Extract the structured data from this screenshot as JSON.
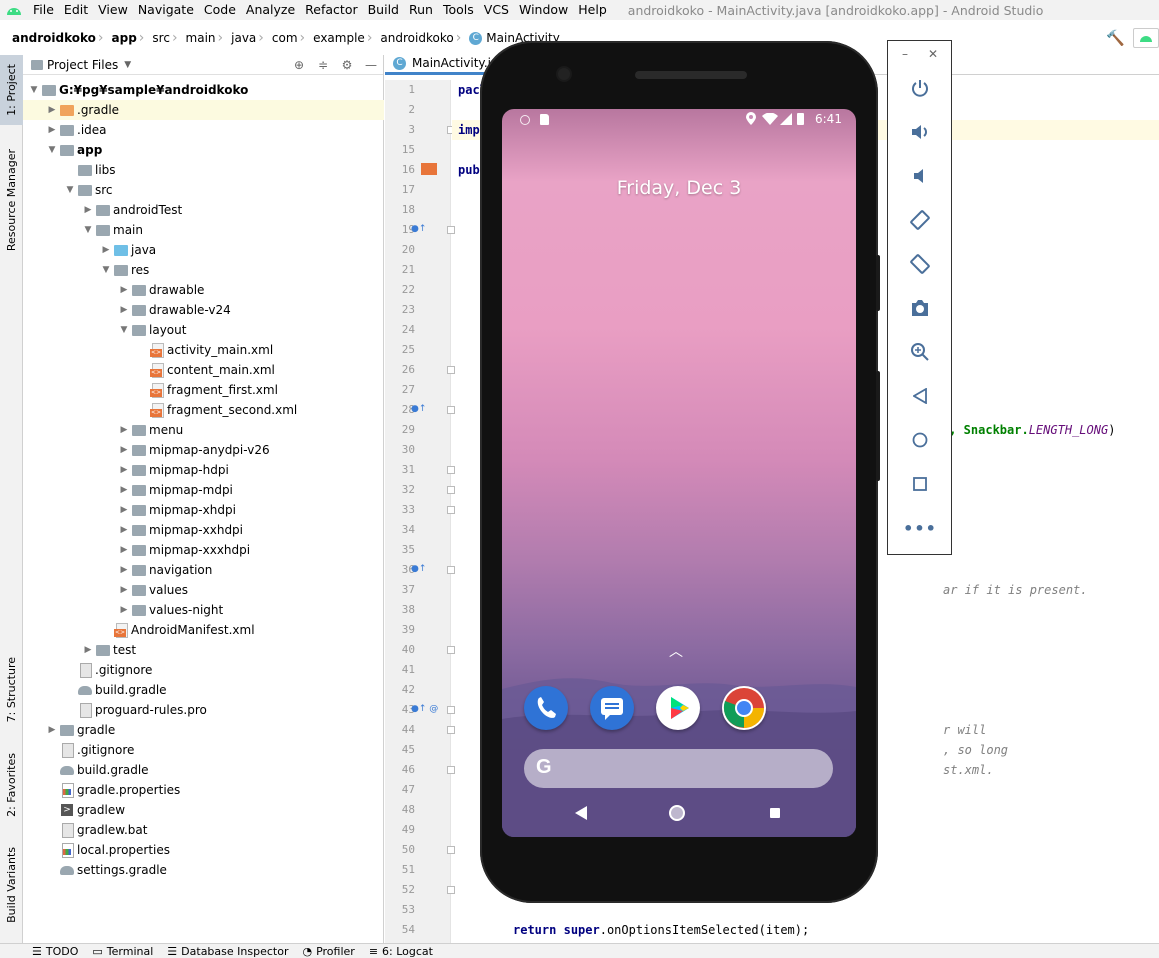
{
  "menubar": {
    "items": [
      "File",
      "Edit",
      "View",
      "Navigate",
      "Code",
      "Analyze",
      "Refactor",
      "Build",
      "Run",
      "Tools",
      "VCS",
      "Window",
      "Help"
    ],
    "window_title": "androidkoko - MainActivity.java [androidkoko.app] - Android Studio"
  },
  "breadcrumb": [
    "androidkoko",
    "app",
    "src",
    "main",
    "java",
    "com",
    "example",
    "androidkoko",
    "MainActivity"
  ],
  "left_strip": {
    "project": "1: Project",
    "resource_manager": "Resource Manager",
    "structure": "7: Structure",
    "favorites": "2: Favorites",
    "build_variants": "Build Variants"
  },
  "project_panel": {
    "title": "Project Files",
    "tree": [
      {
        "label": "G:¥pg¥sample¥androidkoko",
        "depth": 0,
        "expanded": true,
        "icon": "folder",
        "bold": true
      },
      {
        "label": ".gradle",
        "depth": 1,
        "expanded": false,
        "icon": "folder-orange",
        "highlight": true
      },
      {
        "label": ".idea",
        "depth": 1,
        "expanded": false,
        "icon": "folder"
      },
      {
        "label": "app",
        "depth": 1,
        "expanded": true,
        "icon": "folder-module",
        "bold": true
      },
      {
        "label": "libs",
        "depth": 2,
        "icon": "folder"
      },
      {
        "label": "src",
        "depth": 2,
        "expanded": true,
        "icon": "folder"
      },
      {
        "label": "androidTest",
        "depth": 3,
        "expanded": false,
        "icon": "folder"
      },
      {
        "label": "main",
        "depth": 3,
        "expanded": true,
        "icon": "folder"
      },
      {
        "label": "java",
        "depth": 4,
        "expanded": false,
        "icon": "folder-blue"
      },
      {
        "label": "res",
        "depth": 4,
        "expanded": true,
        "icon": "folder-res"
      },
      {
        "label": "drawable",
        "depth": 5,
        "expanded": false,
        "icon": "folder"
      },
      {
        "label": "drawable-v24",
        "depth": 5,
        "expanded": false,
        "icon": "folder"
      },
      {
        "label": "layout",
        "depth": 5,
        "expanded": true,
        "icon": "folder"
      },
      {
        "label": "activity_main.xml",
        "depth": 6,
        "icon": "xml"
      },
      {
        "label": "content_main.xml",
        "depth": 6,
        "icon": "xml"
      },
      {
        "label": "fragment_first.xml",
        "depth": 6,
        "icon": "xml"
      },
      {
        "label": "fragment_second.xml",
        "depth": 6,
        "icon": "xml"
      },
      {
        "label": "menu",
        "depth": 5,
        "expanded": false,
        "icon": "folder"
      },
      {
        "label": "mipmap-anydpi-v26",
        "depth": 5,
        "expanded": false,
        "icon": "folder"
      },
      {
        "label": "mipmap-hdpi",
        "depth": 5,
        "expanded": false,
        "icon": "folder"
      },
      {
        "label": "mipmap-mdpi",
        "depth": 5,
        "expanded": false,
        "icon": "folder"
      },
      {
        "label": "mipmap-xhdpi",
        "depth": 5,
        "expanded": false,
        "icon": "folder"
      },
      {
        "label": "mipmap-xxhdpi",
        "depth": 5,
        "expanded": false,
        "icon": "folder"
      },
      {
        "label": "mipmap-xxxhdpi",
        "depth": 5,
        "expanded": false,
        "icon": "folder"
      },
      {
        "label": "navigation",
        "depth": 5,
        "expanded": false,
        "icon": "folder"
      },
      {
        "label": "values",
        "depth": 5,
        "expanded": false,
        "icon": "folder"
      },
      {
        "label": "values-night",
        "depth": 5,
        "expanded": false,
        "icon": "folder"
      },
      {
        "label": "AndroidManifest.xml",
        "depth": 4,
        "icon": "xml"
      },
      {
        "label": "test",
        "depth": 3,
        "expanded": false,
        "icon": "folder"
      },
      {
        "label": ".gitignore",
        "depth": 2,
        "icon": "file"
      },
      {
        "label": "build.gradle",
        "depth": 2,
        "icon": "gradle"
      },
      {
        "label": "proguard-rules.pro",
        "depth": 2,
        "icon": "file"
      },
      {
        "label": "gradle",
        "depth": 1,
        "expanded": false,
        "icon": "folder"
      },
      {
        "label": ".gitignore",
        "depth": 1,
        "icon": "file"
      },
      {
        "label": "build.gradle",
        "depth": 1,
        "icon": "gradle"
      },
      {
        "label": "gradle.properties",
        "depth": 1,
        "icon": "props"
      },
      {
        "label": "gradlew",
        "depth": 1,
        "icon": "term"
      },
      {
        "label": "gradlew.bat",
        "depth": 1,
        "icon": "file"
      },
      {
        "label": "local.properties",
        "depth": 1,
        "icon": "props"
      },
      {
        "label": "settings.gradle",
        "depth": 1,
        "icon": "gradle"
      }
    ]
  },
  "editor": {
    "tab_label": "MainActivity.java",
    "line_numbers": [
      "1",
      "2",
      "3",
      "15",
      "16",
      "17",
      "18",
      "19",
      "20",
      "21",
      "22",
      "23",
      "24",
      "25",
      "26",
      "27",
      "28",
      "29",
      "30",
      "31",
      "32",
      "33",
      "34",
      "35",
      "36",
      "37",
      "38",
      "39",
      "40",
      "41",
      "42",
      "43",
      "44",
      "45",
      "46",
      "47",
      "48",
      "49",
      "50",
      "51",
      "52",
      "53",
      "54"
    ],
    "code_fragments": {
      "l1": "pacl",
      "l3": "impo",
      "l16": "publ",
      "l29_a": "\", Snackbar.",
      "l29_b": "LENGTH_LONG",
      "l29_c": ")",
      "l37": "ar if it is present.",
      "l44": "r will",
      "l45": ", so long",
      "l46": "st.xml.",
      "l54_kw1": "return",
      "l54_kw2": "super",
      "l54_rest": ".onOptionsItemSelected(item);"
    }
  },
  "bottombar": {
    "tabs": [
      "TODO",
      "Terminal",
      "Database Inspector",
      "Profiler",
      "6: Logcat"
    ]
  },
  "emulator": {
    "status_time": "6:41",
    "date_text": "Friday, Dec 3",
    "search_g": "G"
  },
  "colors": {
    "accent": "#4083c9",
    "editor_line_highlight": "#fffae3",
    "tree_highlight": "#fcfae0"
  }
}
